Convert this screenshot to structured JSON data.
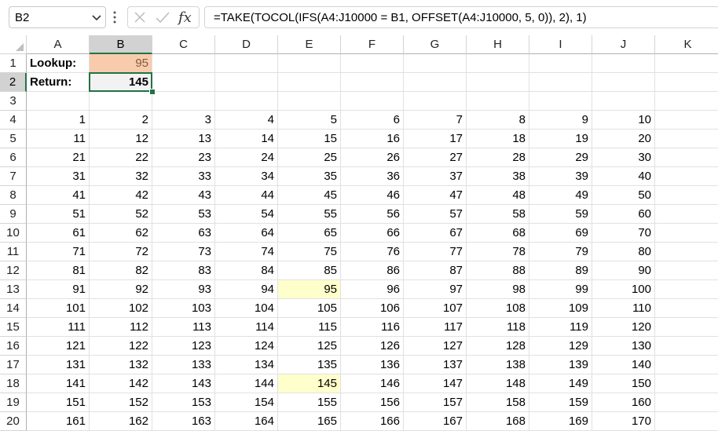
{
  "formula_bar": {
    "name_box": "B2",
    "formula": "=TAKE(TOCOL(IFS(A4:J10000 = B1, OFFSET(A4:J10000, 5, 0)), 2), 1)"
  },
  "sheet": {
    "columns": [
      "A",
      "B",
      "C",
      "D",
      "E",
      "F",
      "G",
      "H",
      "I",
      "J",
      "K"
    ],
    "rows": [
      "1",
      "2",
      "3",
      "4",
      "5",
      "6",
      "7",
      "8",
      "9",
      "10",
      "11",
      "12",
      "13",
      "14",
      "15",
      "16",
      "17",
      "18",
      "19",
      "20"
    ],
    "selected_cell": "B2",
    "lookup_label": "Lookup:",
    "lookup_value": "95",
    "return_label": "Return:",
    "return_value": "145",
    "data": [
      [
        "1",
        "2",
        "3",
        "4",
        "5",
        "6",
        "7",
        "8",
        "9",
        "10"
      ],
      [
        "11",
        "12",
        "13",
        "14",
        "15",
        "16",
        "17",
        "18",
        "19",
        "20"
      ],
      [
        "21",
        "22",
        "23",
        "24",
        "25",
        "26",
        "27",
        "28",
        "29",
        "30"
      ],
      [
        "31",
        "32",
        "33",
        "34",
        "35",
        "36",
        "37",
        "38",
        "39",
        "40"
      ],
      [
        "41",
        "42",
        "43",
        "44",
        "45",
        "46",
        "47",
        "48",
        "49",
        "50"
      ],
      [
        "51",
        "52",
        "53",
        "54",
        "55",
        "56",
        "57",
        "58",
        "59",
        "60"
      ],
      [
        "61",
        "62",
        "63",
        "64",
        "65",
        "66",
        "67",
        "68",
        "69",
        "70"
      ],
      [
        "71",
        "72",
        "73",
        "74",
        "75",
        "76",
        "77",
        "78",
        "79",
        "80"
      ],
      [
        "81",
        "82",
        "83",
        "84",
        "85",
        "86",
        "87",
        "88",
        "89",
        "90"
      ],
      [
        "91",
        "92",
        "93",
        "94",
        "95",
        "96",
        "97",
        "98",
        "99",
        "100"
      ],
      [
        "101",
        "102",
        "103",
        "104",
        "105",
        "106",
        "107",
        "108",
        "109",
        "110"
      ],
      [
        "111",
        "112",
        "113",
        "114",
        "115",
        "116",
        "117",
        "118",
        "119",
        "120"
      ],
      [
        "121",
        "122",
        "123",
        "124",
        "125",
        "126",
        "127",
        "128",
        "129",
        "130"
      ],
      [
        "131",
        "132",
        "133",
        "134",
        "135",
        "136",
        "137",
        "138",
        "139",
        "140"
      ],
      [
        "141",
        "142",
        "143",
        "144",
        "145",
        "146",
        "147",
        "148",
        "149",
        "150"
      ],
      [
        "151",
        "152",
        "153",
        "154",
        "155",
        "156",
        "157",
        "158",
        "159",
        "160"
      ],
      [
        "161",
        "162",
        "163",
        "164",
        "165",
        "166",
        "167",
        "168",
        "169",
        "170"
      ]
    ],
    "highlighted_cells": [
      "E13",
      "E18"
    ],
    "colors": {
      "lookup_fill": "#f8cbad",
      "highlight_fill": "#ffffcc",
      "selection_border": "#217346"
    }
  }
}
